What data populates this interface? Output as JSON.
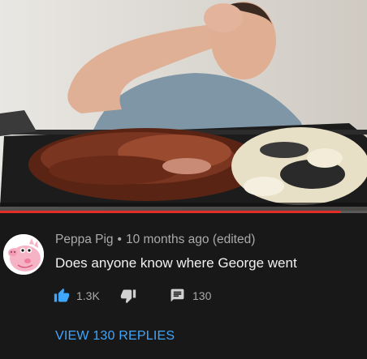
{
  "video": {
    "progress": 0.93,
    "accent_color": "#e52d27"
  },
  "comment": {
    "author": "Peppa Pig",
    "separator": "•",
    "time": "10 months ago (edited)",
    "text": "Does anyone know where George went",
    "avatar": "peppa-pig-avatar",
    "likes": "1.3K",
    "reply_count": "130",
    "view_replies_label": "VIEW 130 REPLIES",
    "like_color": "#3ea6ff"
  }
}
